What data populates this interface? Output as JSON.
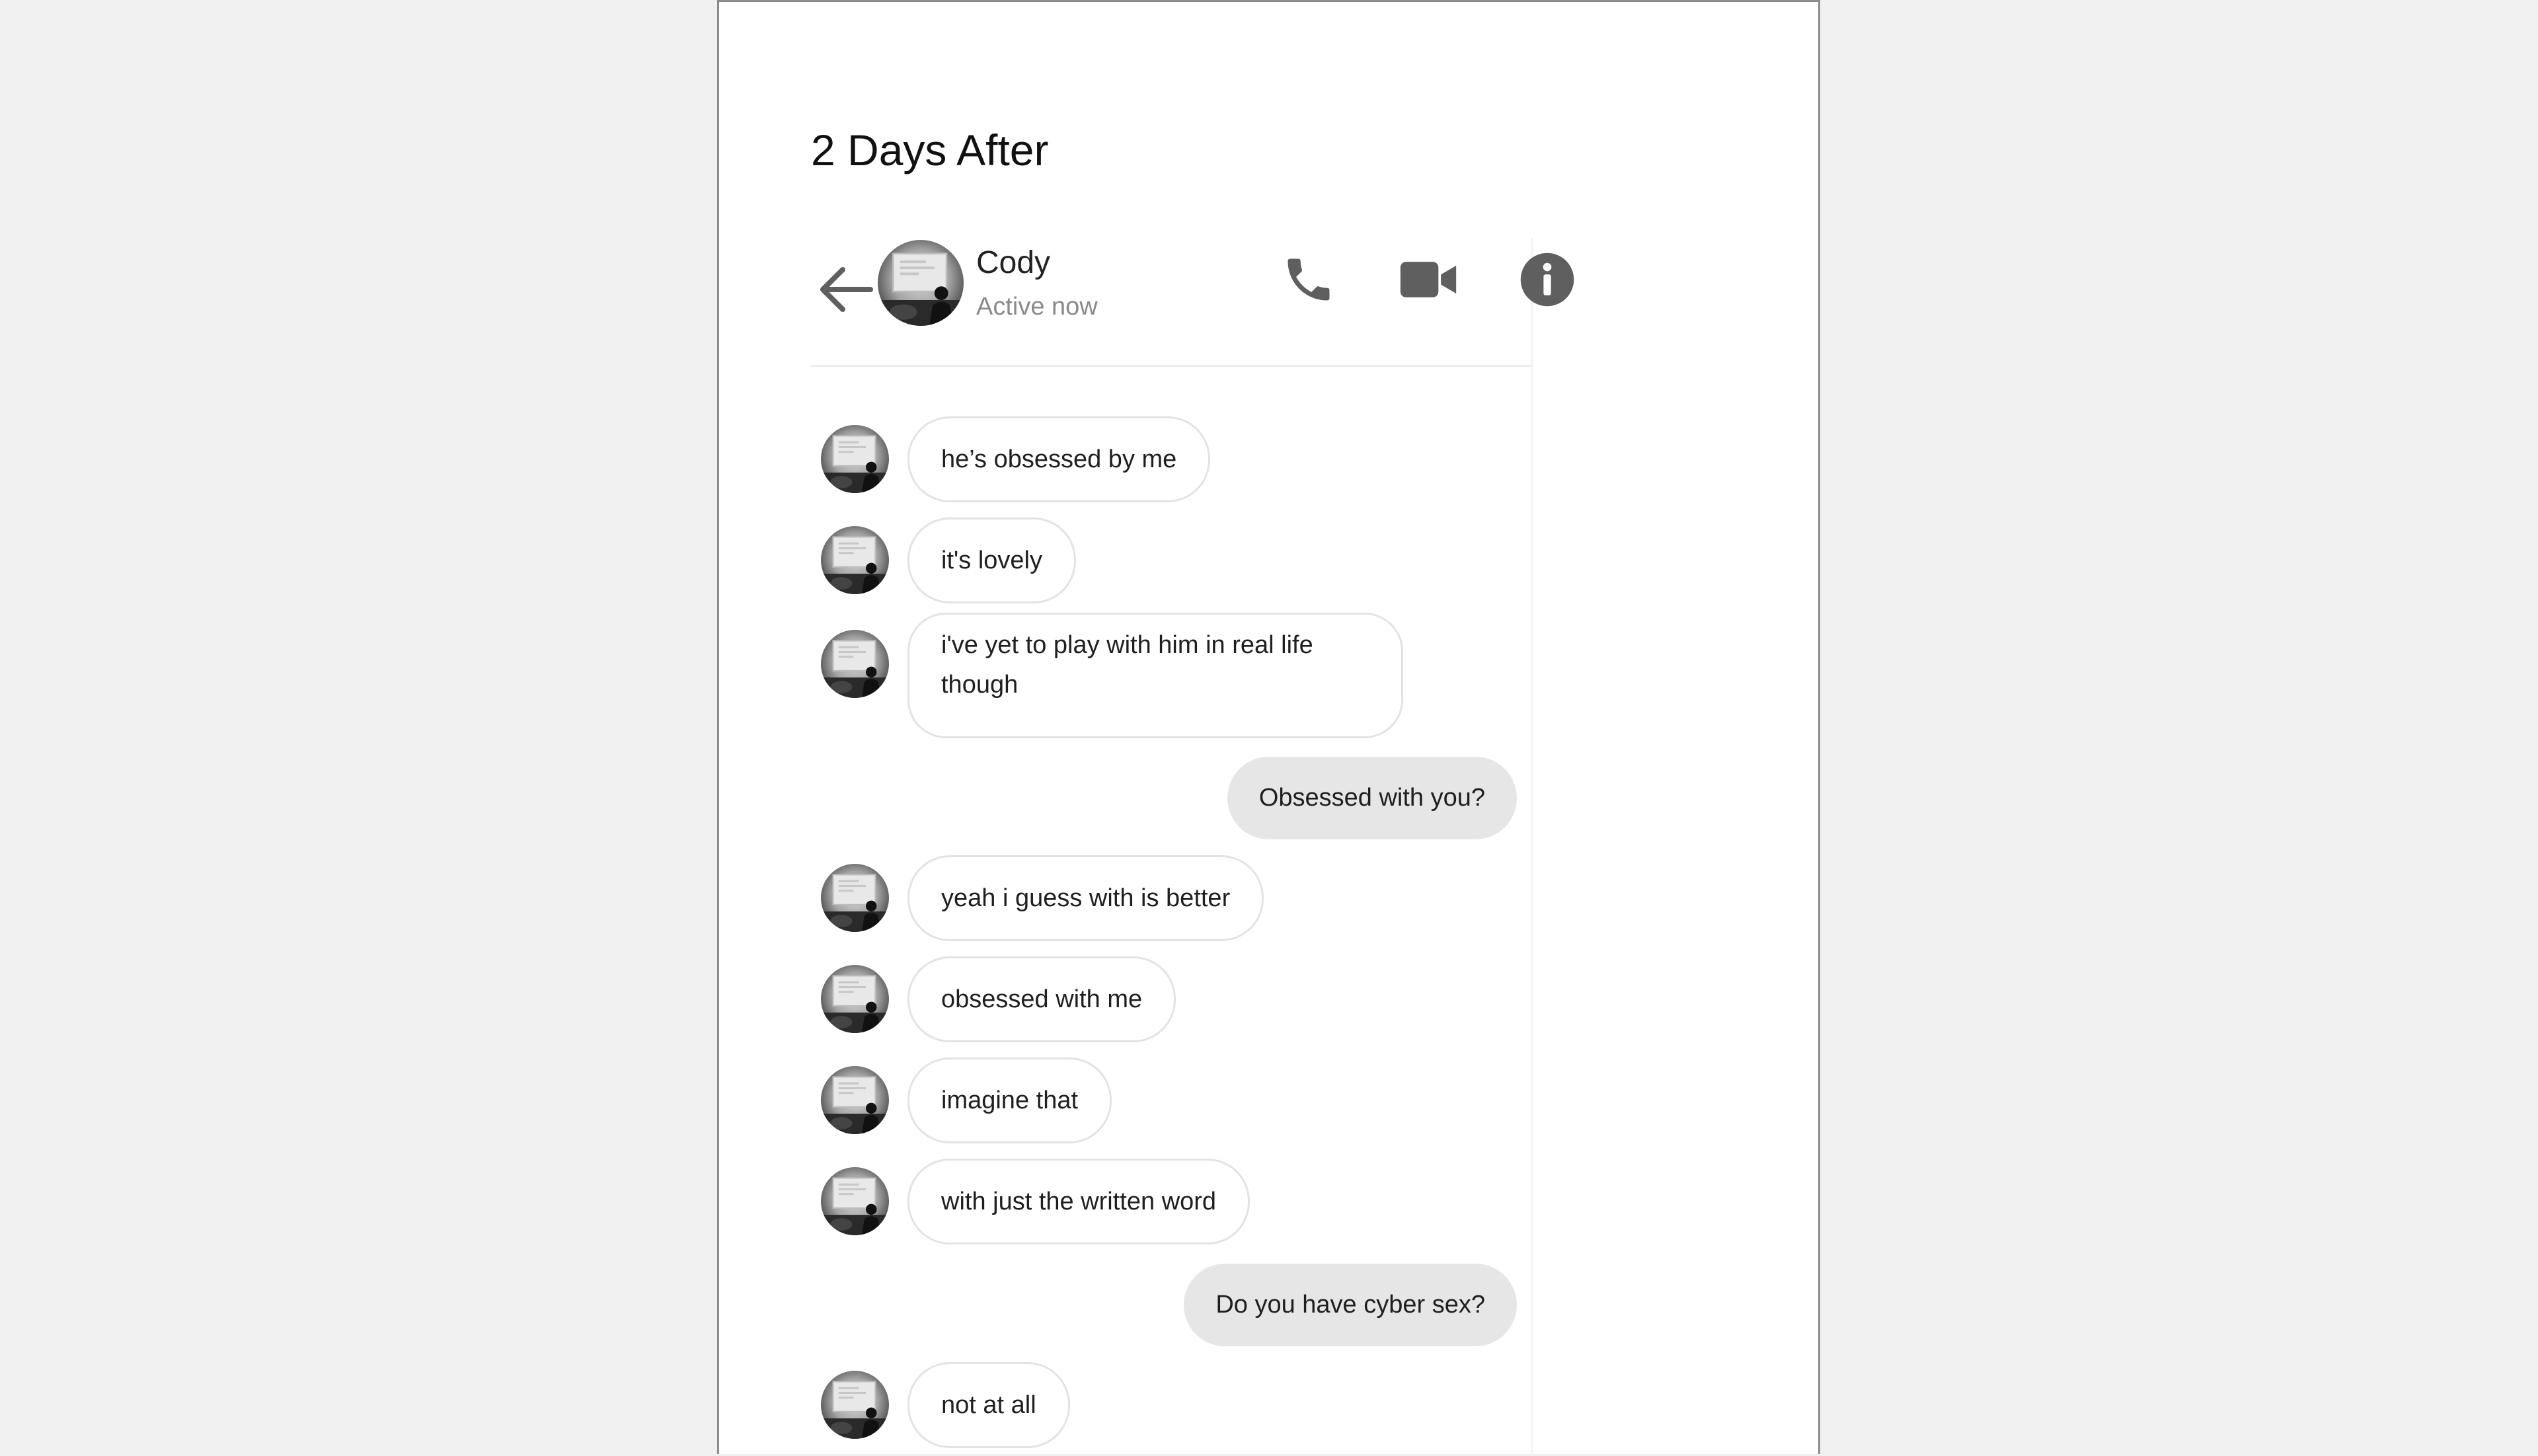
{
  "page": {
    "title": "2 Days After"
  },
  "header": {
    "contact_name": "Cody",
    "status": "Active now",
    "icons": {
      "back": "arrow-left-icon",
      "phone": "phone-icon",
      "video": "video-camera-icon",
      "info": "info-icon"
    }
  },
  "messages": [
    {
      "from": "contact",
      "text": "he’s obsessed by me"
    },
    {
      "from": "contact",
      "text": "it's lovely"
    },
    {
      "from": "contact",
      "text": "i've yet to play with him in real life though"
    },
    {
      "from": "me",
      "text": "Obsessed with you?"
    },
    {
      "from": "contact",
      "text": "yeah i guess with is better"
    },
    {
      "from": "contact",
      "text": "obsessed with me"
    },
    {
      "from": "contact",
      "text": "imagine that"
    },
    {
      "from": "contact",
      "text": "with just the written word"
    },
    {
      "from": "me",
      "text": "Do you have cyber sex?"
    },
    {
      "from": "contact",
      "text": "not at all"
    }
  ],
  "colors": {
    "background": "#f0f0f0",
    "page": "#ffffff",
    "icon": "#5f5f5f",
    "outgoing_bubble": "#e6e6e6",
    "incoming_border": "#e3e3e3",
    "status_text": "#8a8a8a"
  }
}
